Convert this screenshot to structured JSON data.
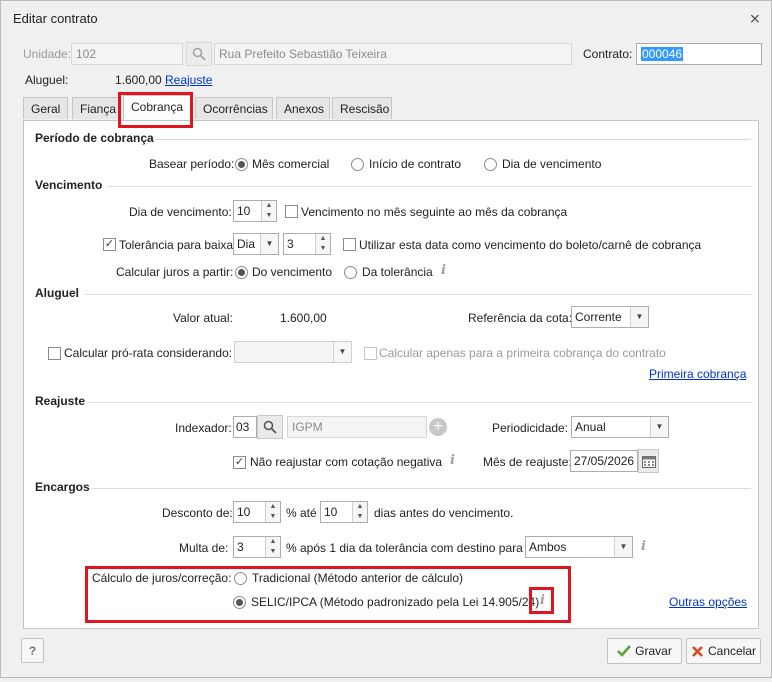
{
  "window": {
    "title": "Editar contrato",
    "close_glyph": "⨯"
  },
  "header": {
    "unidade_label": "Unidade:",
    "unidade_value": "102",
    "address": "Rua Prefeito Sebastião Teixeira",
    "contrato_label": "Contrato:",
    "contrato_value": "000046",
    "aluguel_label": "Aluguel:",
    "aluguel_value": "1.600,00",
    "reajuste_link": "Reajuste"
  },
  "tabs": [
    "Geral",
    "Fiança",
    "Cobrança",
    "Ocorrências",
    "Anexos",
    "Rescisão"
  ],
  "active_tab": "Cobrança",
  "periodo": {
    "heading": "Período de cobrança",
    "basear_label": "Basear período:",
    "options": [
      "Mês comercial",
      "Início de contrato",
      "Dia de vencimento"
    ],
    "selected": "Mês comercial"
  },
  "vencimento": {
    "heading": "Vencimento",
    "dia_label": "Dia de vencimento:",
    "dia_value": "10",
    "mes_seguinte_label": "Vencimento no mês seguinte ao mês da cobrança",
    "tolerancia_label": "Tolerância para baixa:",
    "tolerancia_unit": "Dia",
    "tolerancia_value": "3",
    "utilizar_label": "Utilizar esta data como vencimento do boleto/carnê de cobrança",
    "juros_label": "Calcular juros a partir:",
    "juros_options": [
      "Do vencimento",
      "Da tolerância"
    ]
  },
  "aluguel": {
    "heading": "Aluguel",
    "valor_label": "Valor atual:",
    "valor_value": "1.600,00",
    "referencia_label": "Referência da cota:",
    "referencia_value": "Corrente",
    "prorata_label": "Calcular pró-rata considerando:",
    "apenas_label": "Calcular apenas para a primeira cobrança do contrato",
    "primeira_link": "Primeira cobrança"
  },
  "reajuste": {
    "heading": "Reajuste",
    "indexador_label": "Indexador:",
    "indexador_code": "03",
    "indexador_name": "IGPM",
    "periodicidade_label": "Periodicidade:",
    "periodicidade_value": "Anual",
    "nao_reajustar_label": "Não reajustar com cotação negativa",
    "mes_label": "Mês de reajuste:",
    "mes_value": "27/05/2026"
  },
  "encargos": {
    "heading": "Encargos",
    "desconto_label": "Desconto de:",
    "desconto_value": "10",
    "ate_label": "% até",
    "ate_value": "10",
    "dias_label": "dias antes do vencimento.",
    "multa_label": "Multa de:",
    "multa_value": "3",
    "multa_suffix": "% após 1 dia da tolerância  com destino para",
    "destino_value": "Ambos",
    "calculo_label": "Cálculo de juros/correção:",
    "calculo_options": [
      "Tradicional (Método anterior de cálculo)",
      "SELIC/IPCA (Método padronizado pela Lei 14.905/24)"
    ],
    "calculo_selected": "SELIC/IPCA (Método padronizado pela Lei 14.905/24)",
    "outras_link": "Outras opções"
  },
  "footer": {
    "help": "?",
    "gravar": "Gravar",
    "cancelar": "Cancelar"
  },
  "colors": {
    "highlight": "#e0151f",
    "link": "#0033cc",
    "selection": "#3399ff",
    "gravar_check": "#5aa33a",
    "cancel_x": "#d9481f"
  }
}
